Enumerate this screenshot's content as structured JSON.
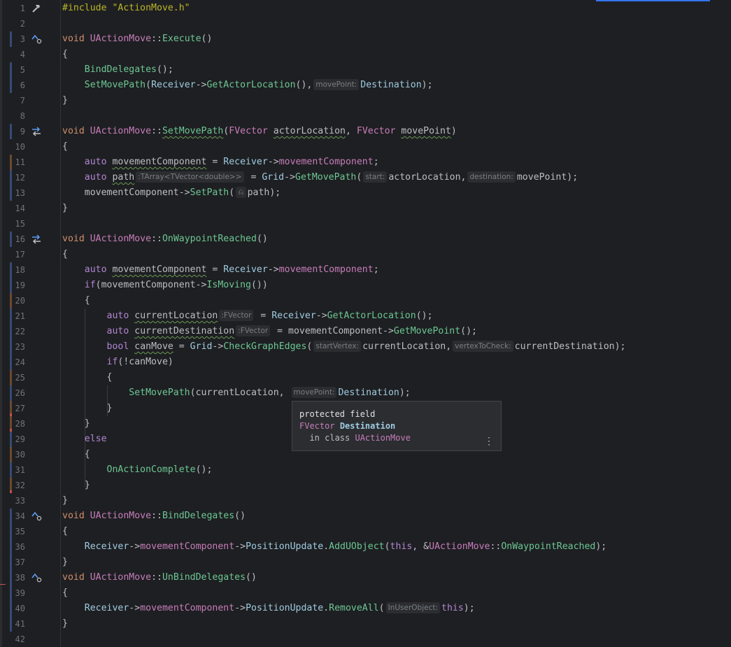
{
  "editor": {
    "line_numbers": [
      "1",
      "2",
      "3",
      "4",
      "5",
      "6",
      "7",
      "8",
      "9",
      "10",
      "11",
      "12",
      "13",
      "14",
      "15",
      "16",
      "17",
      "18",
      "19",
      "20",
      "21",
      "22",
      "23",
      "24",
      "25",
      "26",
      "27",
      "28",
      "29",
      "30",
      "31",
      "32",
      "33",
      "34",
      "35",
      "36",
      "37",
      "38",
      "39",
      "40",
      "41",
      "42"
    ],
    "include": "#include \"ActionMove.h\"",
    "hints": {
      "move_point": "movePoint:",
      "path_type": ":TArray<TVector<double>>",
      "start": "start:",
      "destination": "destination:",
      "ref": "⎌",
      "fvector": ":FVector",
      "start_vertex": "startVertex:",
      "vertex_to_check": "vertexToCheck:",
      "in_user_object": "InUserObject:"
    }
  },
  "tooltip": {
    "line1": "protected field",
    "type": "FVector",
    "name": "Destination",
    "line3_prefix": "in class",
    "class": "UActionMove",
    "more_icon": "⋮"
  },
  "colors": {
    "background": "#1e1f22",
    "function": "#56a8f5",
    "class": "#c77dbb",
    "keyword": "#cf8e6d"
  }
}
